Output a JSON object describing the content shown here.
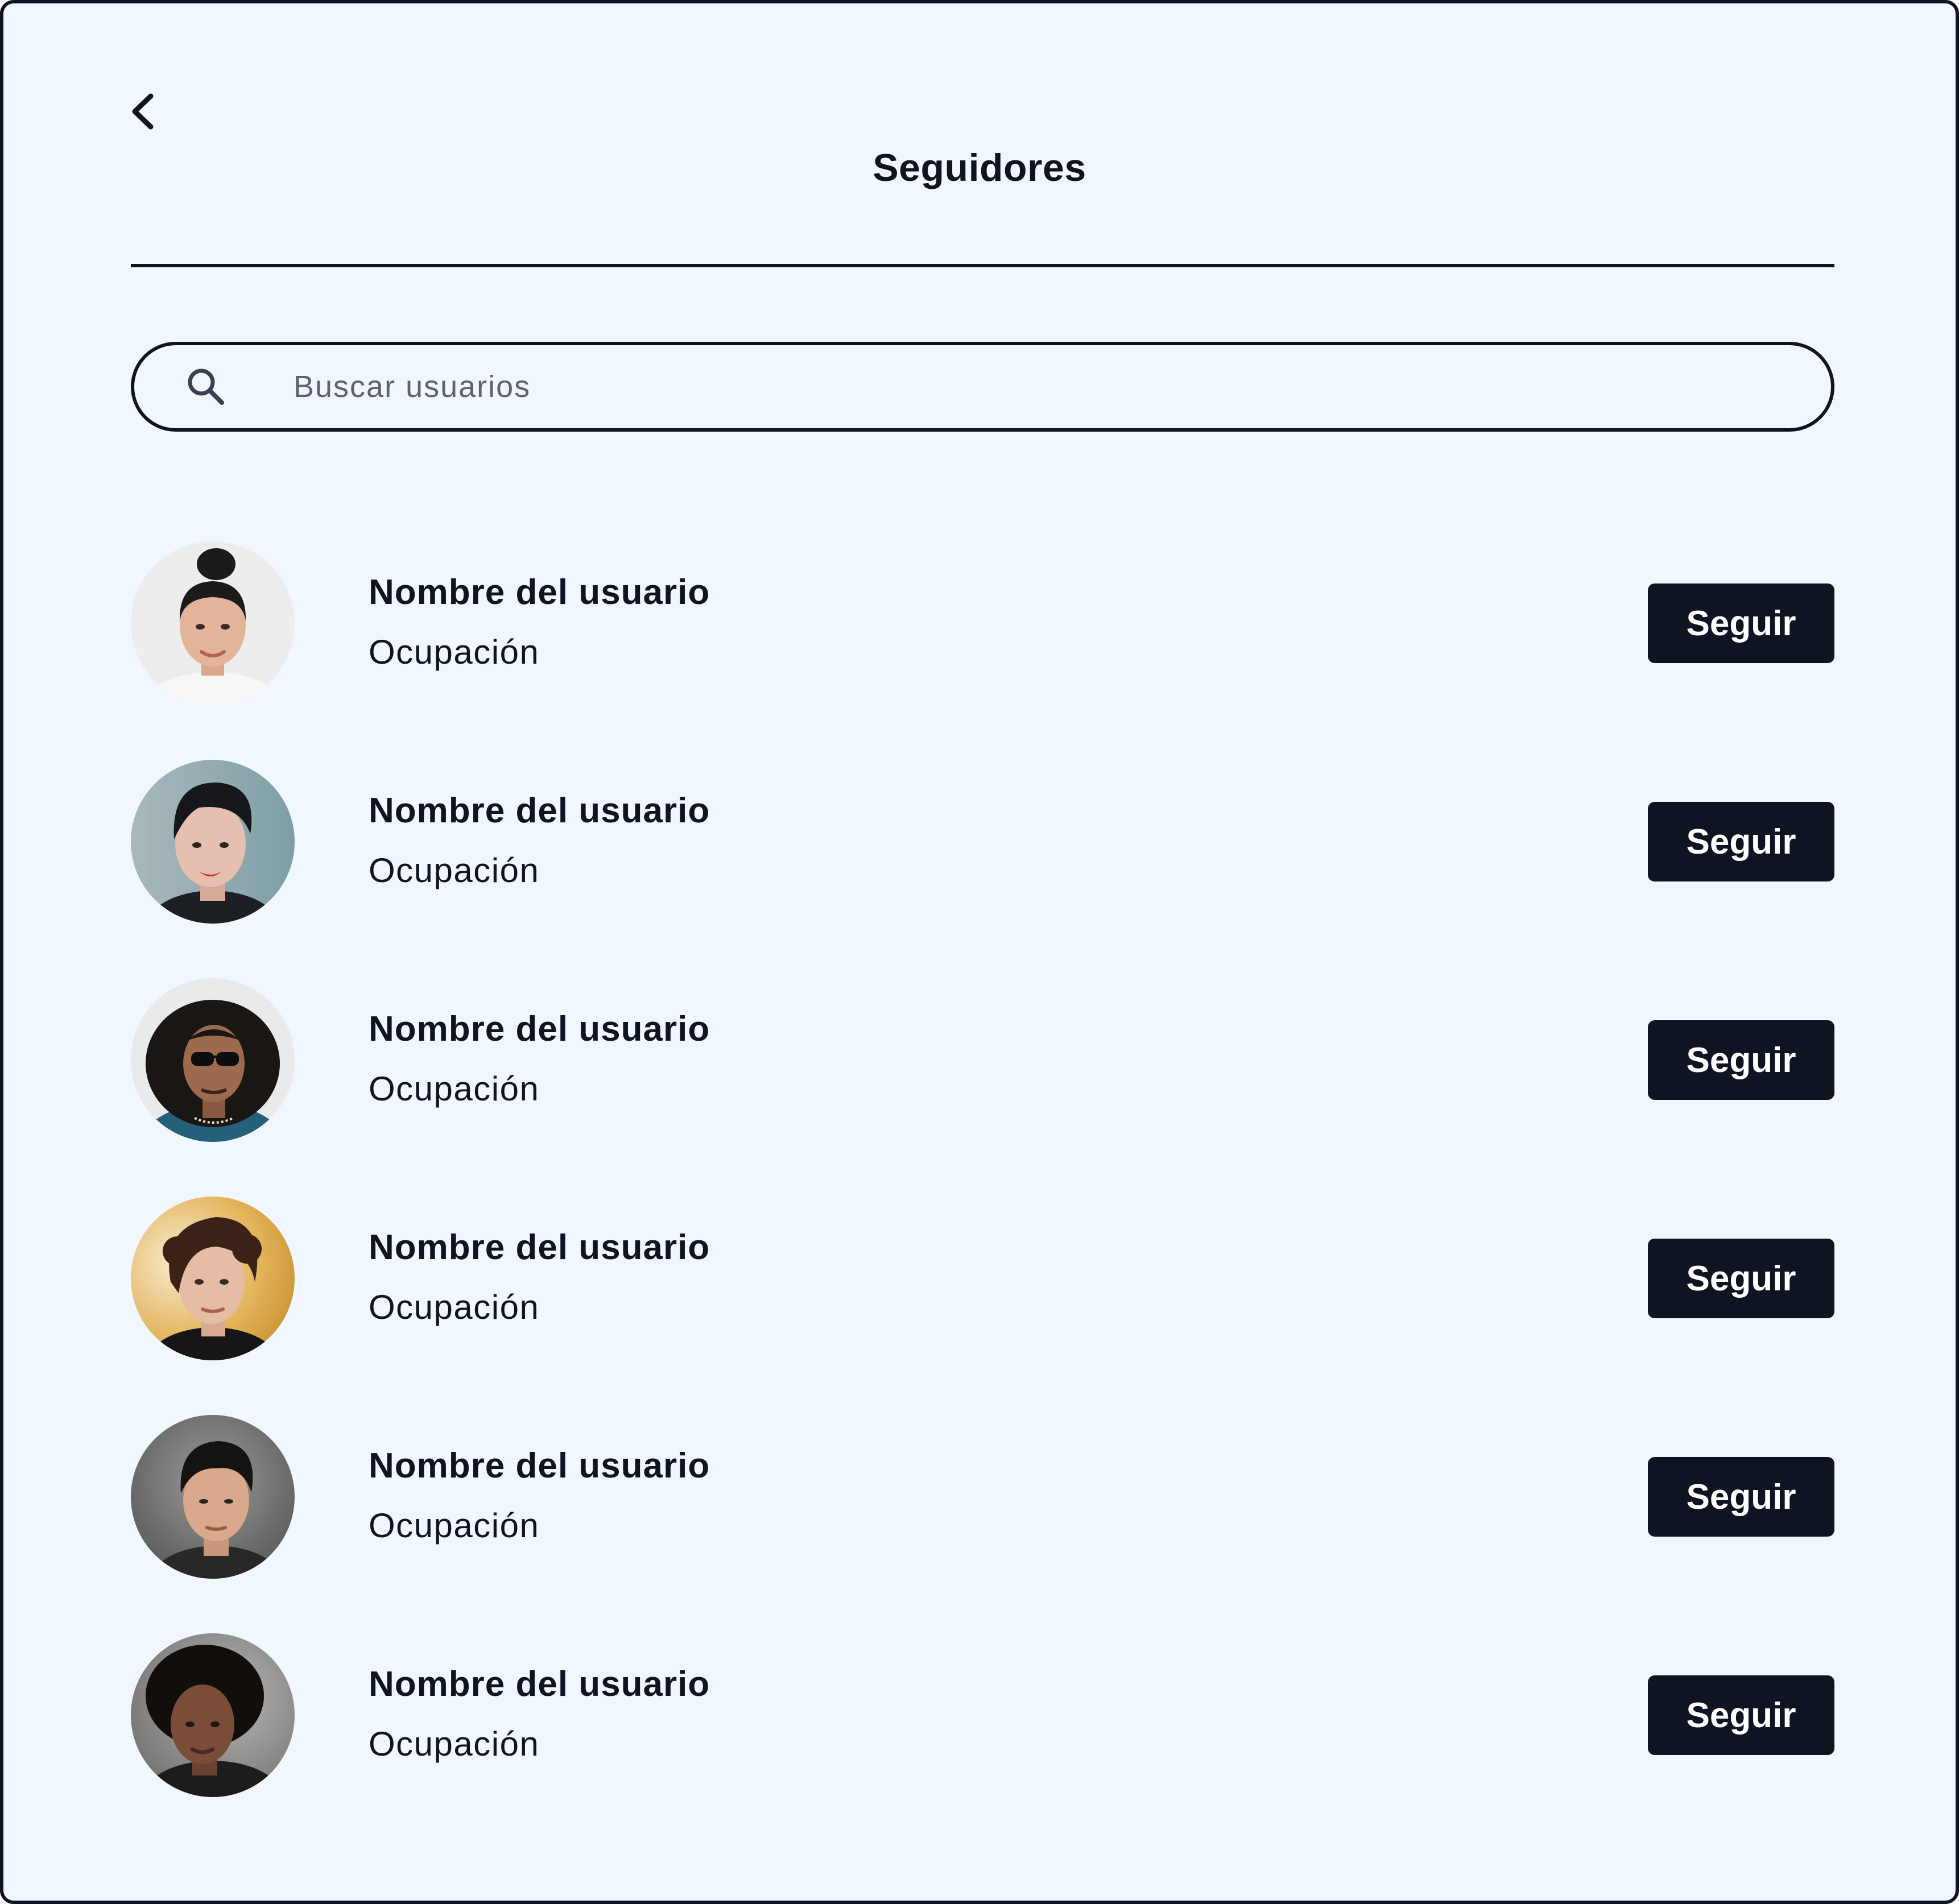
{
  "header": {
    "title": "Seguidores",
    "back_icon": "chevron-left-icon"
  },
  "search": {
    "placeholder": "Buscar usuarios",
    "value": "",
    "icon": "search-icon"
  },
  "users": [
    {
      "name": "Nombre del usuario",
      "occupation": "Ocupación",
      "button_label": "Seguir"
    },
    {
      "name": "Nombre del usuario",
      "occupation": "Ocupación",
      "button_label": "Seguir"
    },
    {
      "name": "Nombre del usuario",
      "occupation": "Ocupación",
      "button_label": "Seguir"
    },
    {
      "name": "Nombre del usuario",
      "occupation": "Ocupación",
      "button_label": "Seguir"
    },
    {
      "name": "Nombre del usuario",
      "occupation": "Ocupación",
      "button_label": "Seguir"
    },
    {
      "name": "Nombre del usuario",
      "occupation": "Ocupación",
      "button_label": "Seguir"
    }
  ],
  "colors": {
    "background": "#f0f7ff",
    "ink": "#0f1423",
    "button_text": "#ffffff",
    "placeholder": "#5b6274"
  }
}
